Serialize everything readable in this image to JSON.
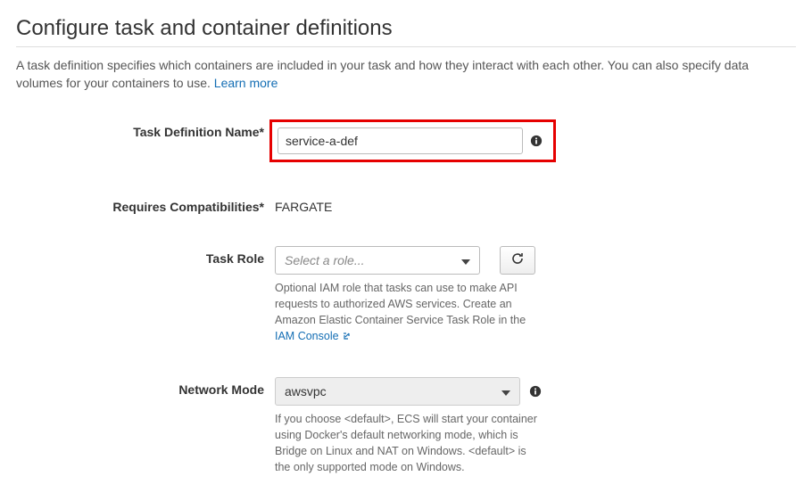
{
  "title": "Configure task and container definitions",
  "description": "A task definition specifies which containers are included in your task and how they interact with each other. You can also specify data volumes for your containers to use. ",
  "learn_more": "Learn more",
  "fields": {
    "task_def_name": {
      "label": "Task Definition Name*",
      "value": "service-a-def"
    },
    "compat": {
      "label": "Requires Compatibilities*",
      "value": "FARGATE"
    },
    "task_role": {
      "label": "Task Role",
      "placeholder": "Select a role...",
      "help_pre": "Optional IAM role that tasks can use to make API requests to authorized AWS services. Create an Amazon Elastic Container Service Task Role in the ",
      "help_link": "IAM Console"
    },
    "network_mode": {
      "label": "Network Mode",
      "value": "awsvpc",
      "help": "If you choose <default>, ECS will start your container using Docker's default networking mode, which is Bridge on Linux and NAT on Windows. <default> is the only supported mode on Windows."
    }
  }
}
